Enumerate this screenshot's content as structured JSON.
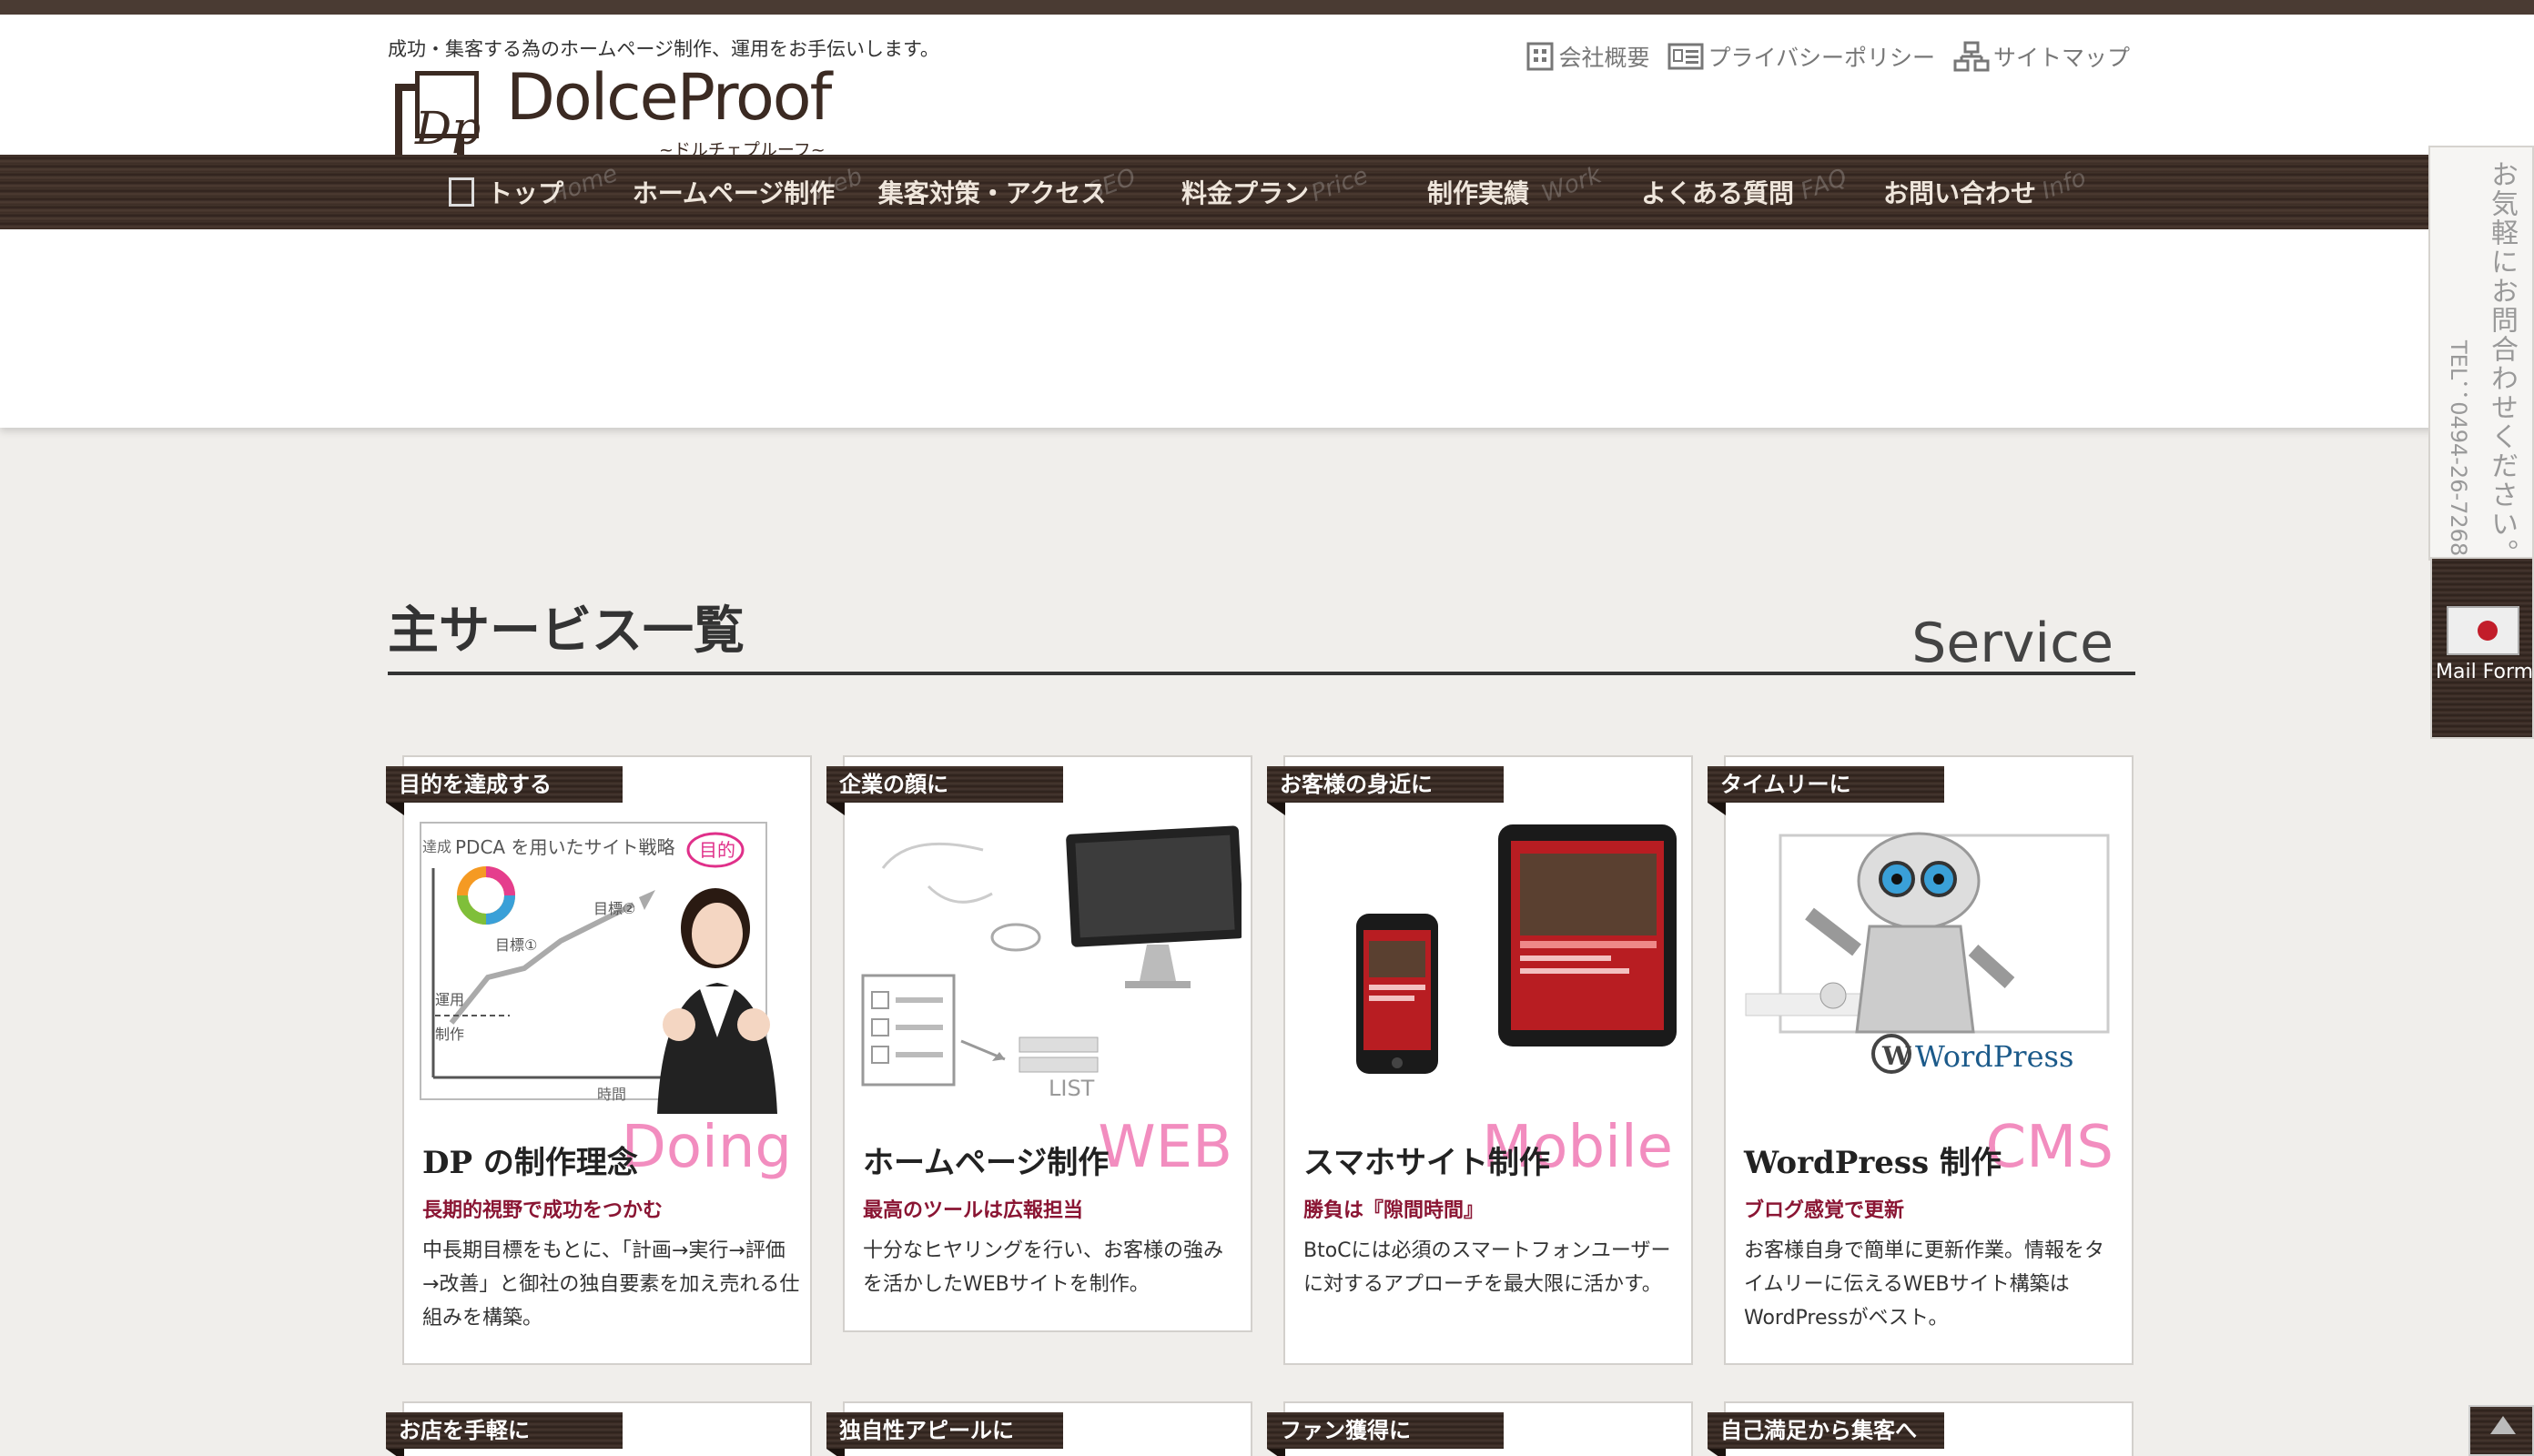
{
  "header": {
    "tagline": "成功・集客する為のホームページ制作、運用をお手伝いします。",
    "logo_name": "DolceProof",
    "logo_kana": "~ドルチェプルーフ~",
    "utility": [
      {
        "label": "会社概要",
        "icon": "building-icon"
      },
      {
        "label": "プライバシーポリシー",
        "icon": "id-card-icon"
      },
      {
        "label": "サイトマップ",
        "icon": "sitemap-icon"
      }
    ]
  },
  "nav": [
    {
      "label": "トップ",
      "ghost": "Home"
    },
    {
      "label": "ホームページ制作",
      "ghost": "Web"
    },
    {
      "label": "集客対策・アクセス",
      "ghost": "SEO"
    },
    {
      "label": "料金プラン",
      "ghost": "Price"
    },
    {
      "label": "制作実績",
      "ghost": "Work"
    },
    {
      "label": "よくある質問",
      "ghost": "FAQ"
    },
    {
      "label": "お問い合わせ",
      "ghost": "Info"
    }
  ],
  "section": {
    "title": "主サービス一覧",
    "title_en": "Service"
  },
  "cards": [
    {
      "ribbon": "目的を達成する",
      "title": "DP の制作理念",
      "accent": "Doing",
      "sub": "長期的視野で成功をつかむ",
      "desc": "中長期目標をもとに、「計画→実行→評価→改善」と御社の独自要素を加え売れる仕組みを構築。",
      "illus": {
        "top": "PDCA を用いたサイト戦略",
        "goal": "目的",
        "y_label": "達成",
        "goal2": "目標②",
        "goal1": "目標①",
        "ops": "運用",
        "make": "制作",
        "x_label": "時間"
      }
    },
    {
      "ribbon": "企業の顔に",
      "title": "ホームページ制作",
      "accent": "WEB",
      "sub": "最高のツールは広報担当",
      "desc": "十分なヒヤリングを行い、お客様の強みを活かしたWEBサイトを制作。",
      "illus": {
        "list": "LIST"
      }
    },
    {
      "ribbon": "お客様の身近に",
      "title": "スマホサイト制作",
      "accent": "Mobile",
      "sub": "勝負は『隙間時間』",
      "desc": "BtoCには必須のスマートフォンユーザーに対するアプローチを最大限に活かす。"
    },
    {
      "ribbon": "タイムリーに",
      "title": "WordPress 制作",
      "accent": "CMS",
      "sub": "ブログ感覚で更新",
      "desc": "お客様自身で簡単に更新作業。情報をタイムリーに伝えるWEBサイト構築はWordPressがベスト。",
      "illus": {
        "brand": "WordPress"
      }
    }
  ],
  "cards_row2": [
    {
      "ribbon": "お店を手軽に"
    },
    {
      "ribbon": "独自性アピールに"
    },
    {
      "ribbon": "ファン獲得に"
    },
    {
      "ribbon": "自己満足から集客へ"
    }
  ],
  "side": {
    "contact_text": "お気軽にお問合わせください。",
    "tel": "TEL：0494-26-7268",
    "mail_label": "Mail Form"
  },
  "colors": {
    "brand_brown": "#3b2a22",
    "accent_pink": "#f07ab4",
    "sub_red": "#8a1533"
  }
}
